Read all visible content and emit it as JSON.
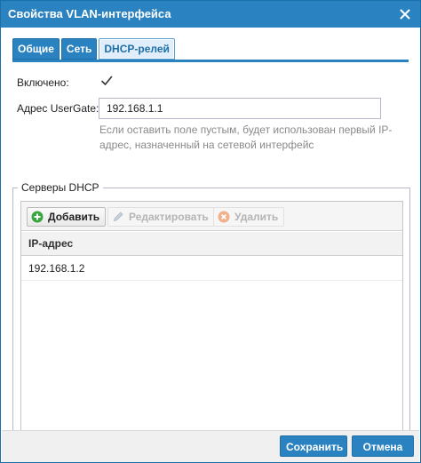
{
  "window": {
    "title": "Свойства VLAN-интерфейса"
  },
  "tabs": [
    {
      "label": "Общие",
      "active": false
    },
    {
      "label": "Сеть",
      "active": false
    },
    {
      "label": "DHCP-релей",
      "active": true
    }
  ],
  "form": {
    "enabled_label": "Включено:",
    "enabled_checked": true,
    "address_label": "Адрес UserGate:",
    "address_value": "192.168.1.1",
    "hint_line1": "Если оставить поле пустым, будет использован первый IP-",
    "hint_line2": "адрес, назначенный на сетевой интерфейс"
  },
  "dhcp_servers": {
    "legend": "Серверы DHCP",
    "toolbar": {
      "add_label": "Добавить",
      "edit_label": "Редактировать",
      "delete_label": "Удалить"
    },
    "columns": [
      "IP-адрес"
    ],
    "rows": [
      "192.168.1.2"
    ]
  },
  "footer": {
    "save_label": "Сохранить",
    "cancel_label": "Отмена"
  },
  "colors": {
    "accent": "#2a82c1",
    "add_icon": "#3aa640",
    "delete_icon": "#f0b08a"
  },
  "icons": {
    "close": "close-icon",
    "checkbox": "checkmark-icon",
    "add": "plus-circle-icon",
    "edit": "pencil-icon",
    "delete": "x-circle-icon"
  }
}
